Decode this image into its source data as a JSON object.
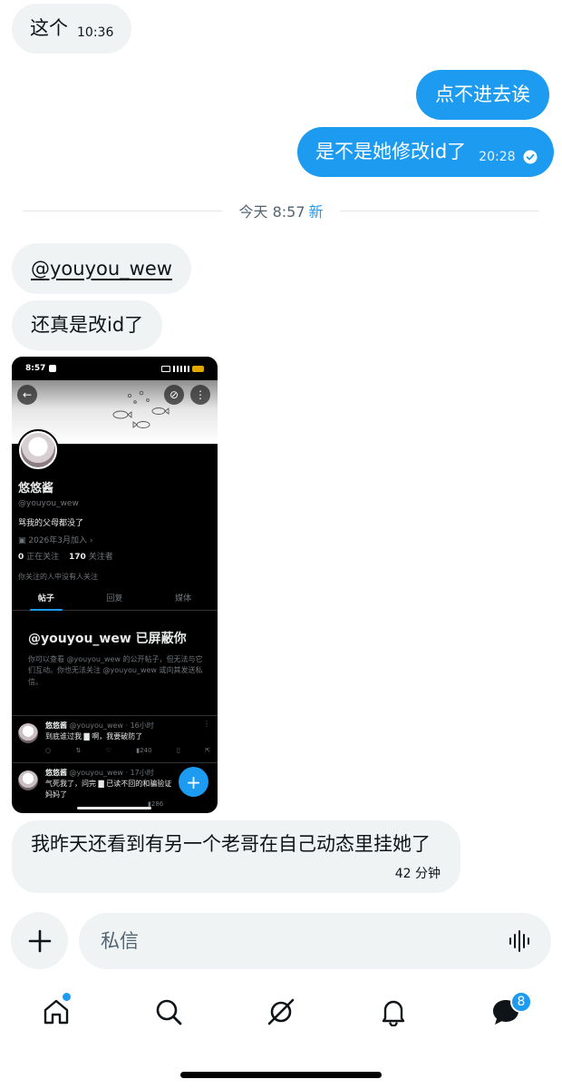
{
  "messages": {
    "m1": {
      "text": "这个",
      "time": "10:36"
    },
    "m2": {
      "text": "点不进去诶"
    },
    "m3": {
      "text": "是不是她修改id了",
      "time": "20:28"
    },
    "divider": {
      "label": "今天 8:57",
      "new_label": "新"
    },
    "m4": {
      "text": "@youyou_wew"
    },
    "m5": {
      "text": "还真是改id了"
    },
    "m6": {
      "text": "我昨天还看到有另一个老哥在自己动态里挂她了",
      "time": "42 分钟"
    }
  },
  "screenshot": {
    "status_time": "8:57",
    "display_name": "悠悠酱",
    "handle": "@youyou_wew",
    "bio": "骂我的父母都没了",
    "joined": "2026年3月加入",
    "following_count": "0",
    "following_label": "正在关注",
    "followers_count": "170",
    "followers_label": "关注者",
    "mutual_note": "你关注的人中没有人关注",
    "tabs": [
      "帖子",
      "回复",
      "媒体"
    ],
    "blocked_title": "@youyou_wew 已屏蔽你",
    "blocked_body": "你可以查看 @youyou_wew 的公开帖子，但无法与它们互动。你也无法关注 @youyou_wew 或向其发送私信。",
    "posts": [
      {
        "name": "悠悠酱",
        "meta": "@youyou_wew · 16小时",
        "text": "到底谁过我 ▇ 啊，我要破防了",
        "views": "240"
      },
      {
        "name": "悠悠酱",
        "meta": "@youyou_wew · 17小时",
        "text": "气死我了，问完 ▇ 已读不回的和骗验证",
        "text2": "妈妈了",
        "views": "286"
      }
    ]
  },
  "composer": {
    "placeholder": "私信"
  },
  "tabbar": {
    "messages_badge": "8"
  },
  "colors": {
    "accent": "#1d9bf0",
    "bubble_in": "#eff3f4",
    "text": "#0f1419",
    "muted": "#536471"
  }
}
